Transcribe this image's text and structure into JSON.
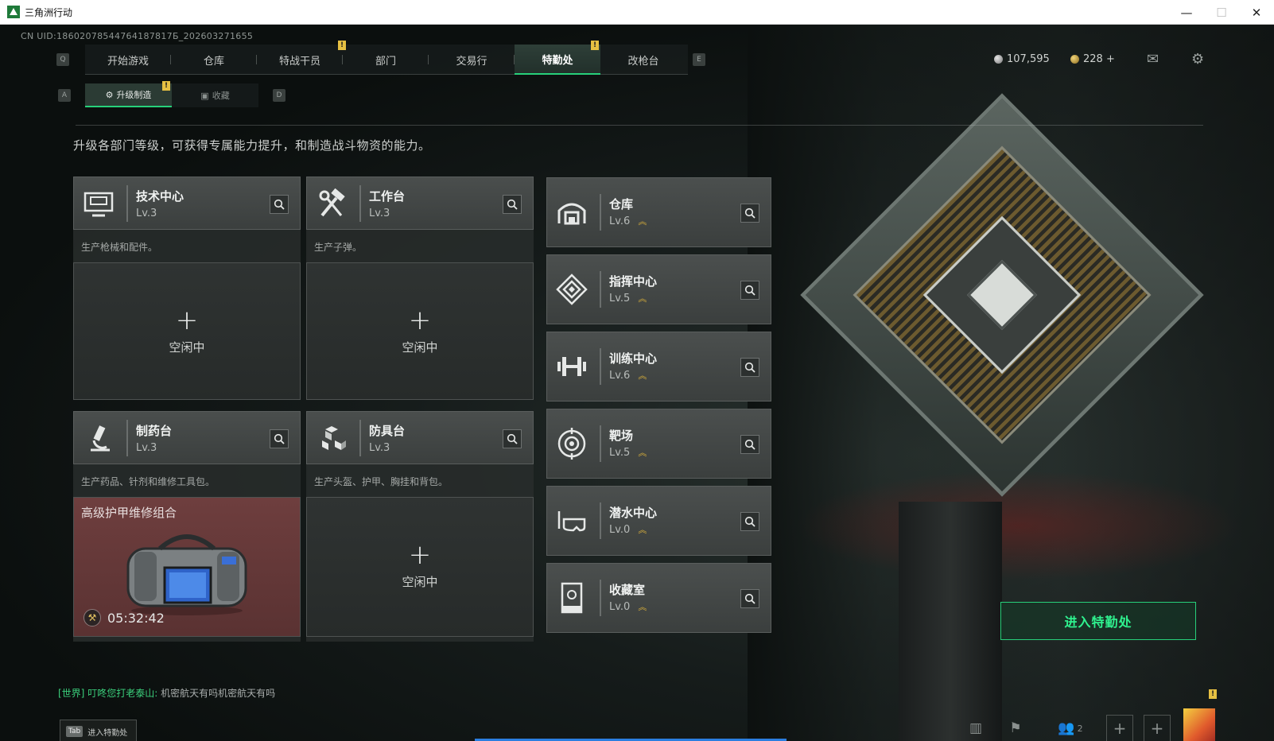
{
  "window": {
    "title": "三角洲行动",
    "min": "—",
    "max": "☐",
    "close": "✕"
  },
  "uid": "CN UID:18602078544764187817Б_202603271655",
  "keys": {
    "q": "Q",
    "e": "E",
    "a": "A",
    "d": "D"
  },
  "topnav": {
    "tabs": [
      "开始游戏",
      "仓库",
      "特战干员",
      "部门",
      "交易行",
      "特勤处",
      "改枪台"
    ],
    "active": "特勤处"
  },
  "alert_mark": "!",
  "currency": {
    "silver": "107,595",
    "gold": "228 +"
  },
  "subnav": {
    "tabs": [
      "升级制造",
      "收藏"
    ],
    "active": "升级制造"
  },
  "description": "升级各部门等级，可获得专属能力提升，和制造战斗物资的能力。",
  "workshops": [
    {
      "name": "技术中心",
      "level": "Lv.3",
      "desc": "生产枪械和配件。",
      "status": "空闲中"
    },
    {
      "name": "工作台",
      "level": "Lv.3",
      "desc": "生产子弹。",
      "status": "空闲中"
    },
    {
      "name": "制药台",
      "level": "Lv.3",
      "desc": "生产药品、针剂和维修工具包。",
      "crafting": {
        "item": "高级护甲维修组合",
        "timer": "05:32:42"
      }
    },
    {
      "name": "防具台",
      "level": "Lv.3",
      "desc": "生产头盔、护甲、胸挂和背包。",
      "status": "空闲中"
    }
  ],
  "plus_sign": "+",
  "departments": [
    {
      "name": "仓库",
      "level": "Lv.6"
    },
    {
      "name": "指挥中心",
      "level": "Lv.5"
    },
    {
      "name": "训练中心",
      "level": "Lv.6"
    },
    {
      "name": "靶场",
      "level": "Lv.5"
    },
    {
      "name": "潜水中心",
      "level": "Lv.0"
    },
    {
      "name": "收藏室",
      "level": "Lv.0"
    }
  ],
  "enter_button": "进入特勤处",
  "chat": {
    "channel": "[世界]",
    "sender": "叮咚您打老泰山:",
    "message": "机密航天有吗机密航天有吗"
  },
  "tab_hint": {
    "key": "Tab",
    "label": "进入特勤处"
  },
  "friends_count": "2",
  "colors": {
    "accent": "#27d07a",
    "alert": "#e6c042",
    "upgrade": "#e1b53a",
    "craft": "#6e3e3e"
  }
}
